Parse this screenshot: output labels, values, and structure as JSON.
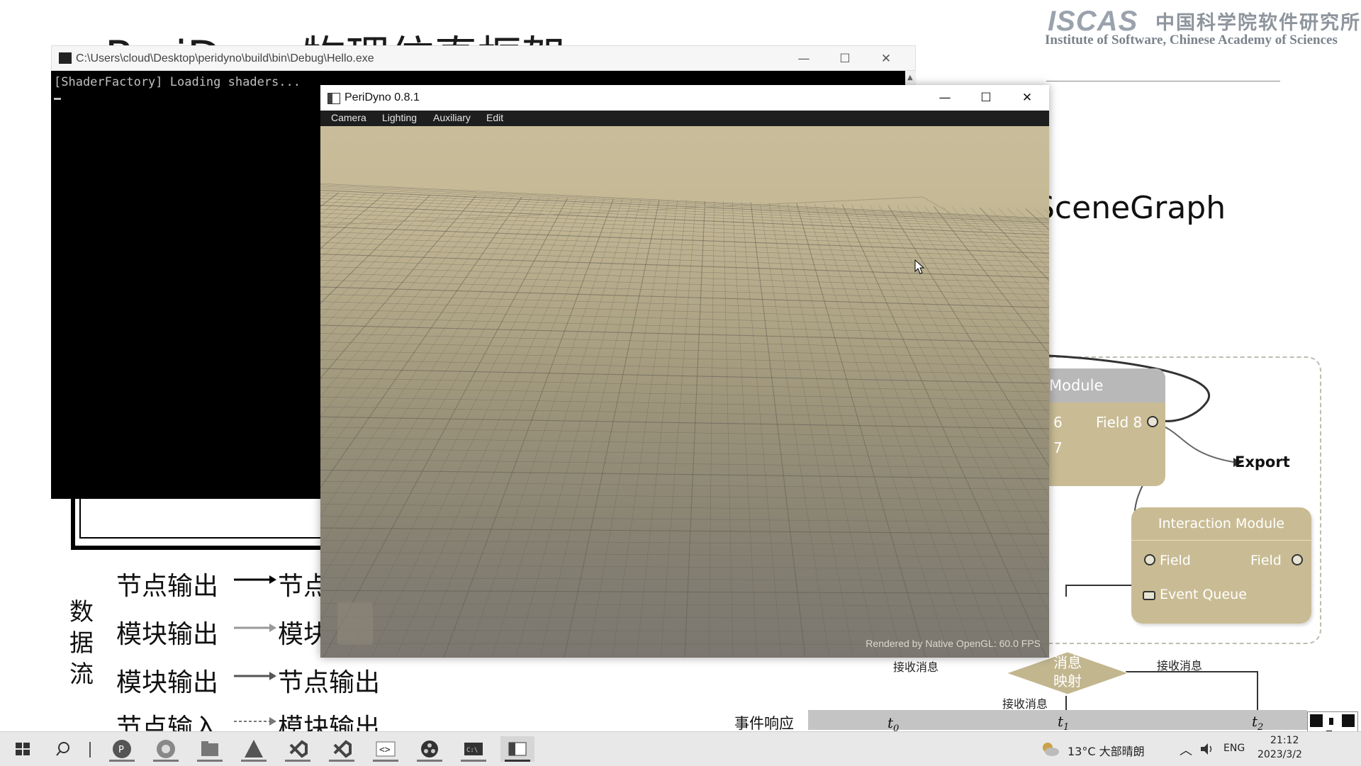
{
  "slide": {
    "title": "PeriDyno物理仿真框架",
    "logo": {
      "mark": "ISCAS",
      "cn": "中国科学院软件研究所",
      "en": "Institute of Software, Chinese Academy of Sciences"
    },
    "scenegraph_text": "SceneGraph",
    "module_node": {
      "title": "Module",
      "field_6": "6",
      "field_7": "7",
      "field_8": "Field 8"
    },
    "export_label": "Export",
    "interaction_module": {
      "title": "Interaction Module",
      "field_in": "Field",
      "field_out": "Field",
      "event_queue": "Event Queue"
    },
    "message_map": {
      "line1": "消息",
      "line2": "映射"
    },
    "receive_labels": [
      "接收消息",
      "接收消息",
      "接收消息"
    ],
    "event_response": "事件响应",
    "timeline_ticks": [
      "t",
      "t",
      "t"
    ],
    "timeline_subs": [
      "0",
      "1",
      "2"
    ],
    "data_flow": {
      "vertical_label": "数据流",
      "rows": [
        {
          "left": "节点输出",
          "right": "节点"
        },
        {
          "left": "模块输出",
          "right": "模块"
        },
        {
          "left": "模块输出",
          "right": "节点输出"
        },
        {
          "left": "节点输入",
          "right": "模块输出"
        }
      ]
    }
  },
  "console": {
    "title": "C:\\Users\\cloud\\Desktop\\peridyno\\build\\bin\\Debug\\Hello.exe",
    "output_line": "[ShaderFactory] Loading shaders...",
    "controls": {
      "minimize": "—",
      "maximize": "☐",
      "close": "✕"
    }
  },
  "peridyno": {
    "title": "PeriDyno 0.8.1",
    "menu": [
      "Camera",
      "Lighting",
      "Auxiliary",
      "Edit"
    ],
    "status": "Rendered by Native OpenGL: 60.0 FPS",
    "controls": {
      "minimize": "—",
      "maximize": "☐",
      "close": "✕"
    },
    "colors": {
      "sky": "#c8bc9a",
      "ground": "#7b7770",
      "grid": "#5e5a52"
    }
  },
  "taskbar": {
    "weather": "13°C  大部晴朗",
    "language": "ENG",
    "time": "21:12",
    "date": "2023/3/2",
    "apps": [
      "start-icon",
      "search-icon",
      "powerpoint-icon",
      "chrome-icon",
      "file-explorer-icon",
      "cmake-icon",
      "visual-studio-icon",
      "visual-studio-icon",
      "vscode-icon",
      "obs-icon",
      "terminal-icon",
      "peridyno-app-icon"
    ]
  }
}
